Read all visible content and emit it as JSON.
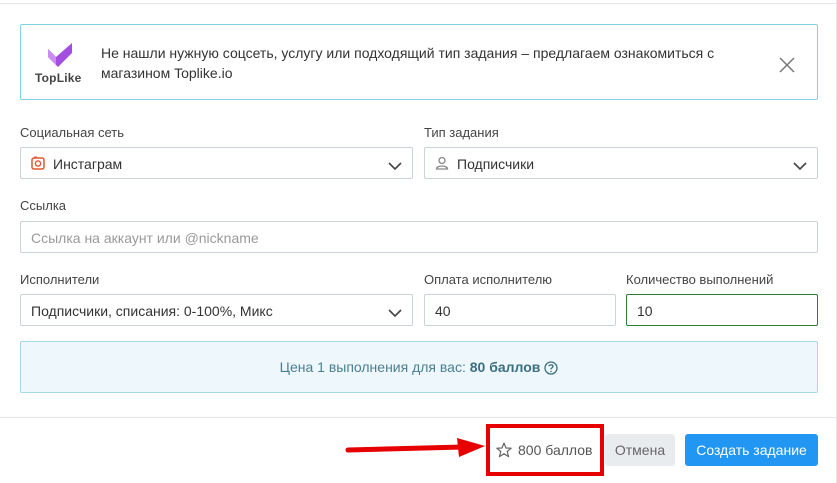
{
  "notice": {
    "logo_text": "TopLike",
    "text": "Не нашли нужную соцсеть, услугу или подходящий тип задания – предлагаем ознакомиться с магазином Toplike.io"
  },
  "form": {
    "social": {
      "label": "Социальная сеть",
      "value": "Инстаграм"
    },
    "task_type": {
      "label": "Тип задания",
      "value": "Подписчики"
    },
    "link": {
      "label": "Ссылка",
      "placeholder": "Ссылка на аккаунт или @nickname"
    },
    "performers": {
      "label": "Исполнители",
      "value": "Подписчики, списания: 0-100%, Микс"
    },
    "payment": {
      "label": "Оплата исполнителю",
      "value": "40"
    },
    "count": {
      "label": "Количество выполнений",
      "value": "10"
    }
  },
  "price": {
    "prefix": "Цена 1 выполнения для вас: ",
    "value": "80 баллов"
  },
  "footer": {
    "total": "800 баллов",
    "cancel_label": "Отмена",
    "create_label": "Создать задание"
  },
  "colors": {
    "primary": "#2196f3",
    "highlight": "#e60000",
    "notice_border": "#7fd3e6",
    "price_bg": "#eef7fb",
    "logo": "#a44ee0",
    "instagram_icon": "#e4572e"
  }
}
